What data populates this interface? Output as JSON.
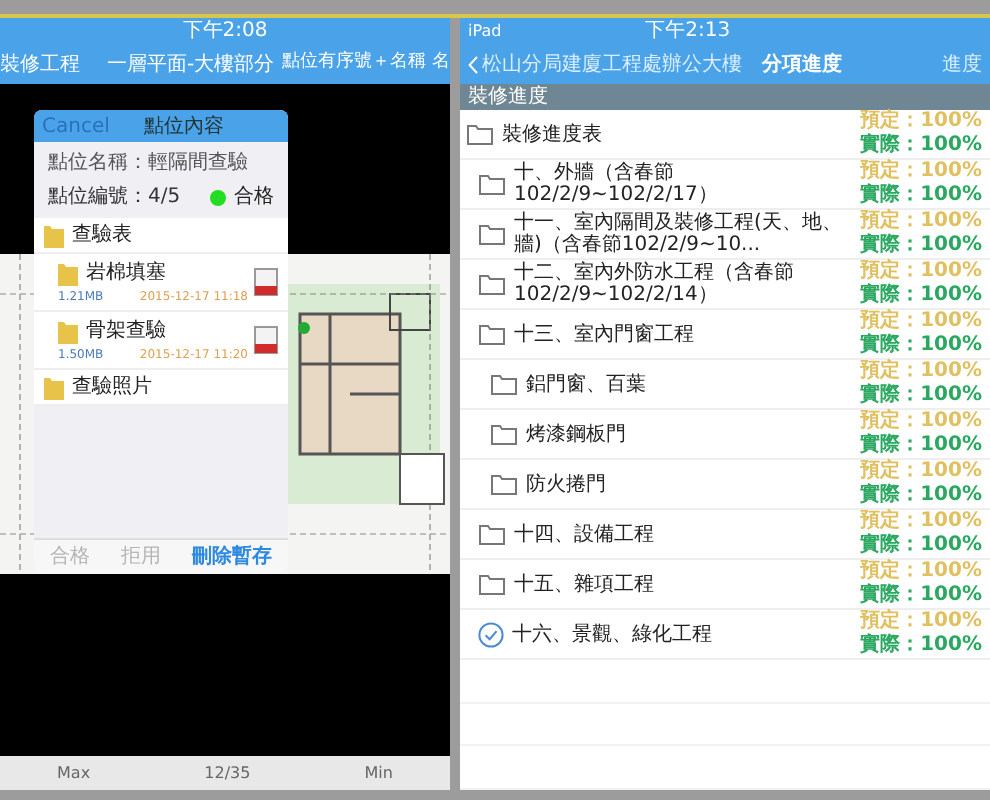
{
  "left": {
    "status_time": "下午2:08",
    "nav": {
      "back_title": "裝修工程",
      "title": "一層平面-大樓部分",
      "right": "點位有序號＋名稱 名"
    },
    "dialog": {
      "cancel": "Cancel",
      "title": "點位內容",
      "point_name": "點位名稱：輕隔間查驗",
      "point_number": "點位編號：4/5",
      "status": {
        "label": "合格",
        "color": "#22dd22"
      },
      "items": [
        {
          "kind": "folder",
          "name": "查驗表",
          "children": [
            {
              "kind": "file",
              "name": "岩棉填塞",
              "size": "1.21MB",
              "time": "2015-12-17 11:18"
            },
            {
              "kind": "file",
              "name": "骨架查驗",
              "size": "1.50MB",
              "time": "2015-12-17 11:20"
            }
          ]
        },
        {
          "kind": "folder",
          "name": "查驗照片"
        }
      ],
      "actions": [
        {
          "label": "合格",
          "disabled": true
        },
        {
          "label": "拒用",
          "disabled": true
        },
        {
          "label": "刪除暫存",
          "disabled": false
        }
      ]
    },
    "footer": [
      "Max",
      "12/35",
      "Min"
    ]
  },
  "right": {
    "status_device": "iPad",
    "status_time": "下午2:13",
    "nav": {
      "back_title": "松山分局建廈工程處辦公大樓",
      "title": "分項進度",
      "right": "進度"
    },
    "section": "裝修進度",
    "rows": [
      {
        "kind": "folder",
        "name": "裝修進度表",
        "planned": "預定：100%",
        "actual": "實際：100%",
        "children": [
          {
            "kind": "folder",
            "name": "十、外牆（含春節102/2/9~102/2/17）",
            "planned": "預定：100%",
            "actual": "實際：100%"
          },
          {
            "kind": "folder",
            "name": "十一、室內隔間及裝修工程(天、地、牆)（含春節102/2/9~10...",
            "planned": "預定：100%",
            "actual": "實際：100%"
          },
          {
            "kind": "folder",
            "name": "十二、室內外防水工程（含春節102/2/9~102/2/14）",
            "planned": "預定：100%",
            "actual": "實際：100%"
          },
          {
            "kind": "folder",
            "name": "十三、室內門窗工程",
            "planned": "預定：100%",
            "actual": "實際：100%",
            "children": [
              {
                "kind": "folder",
                "name": "鋁門窗、百葉",
                "planned": "預定：100%",
                "actual": "實際：100%"
              },
              {
                "kind": "folder",
                "name": "烤漆鋼板門",
                "planned": "預定：100%",
                "actual": "實際：100%"
              },
              {
                "kind": "folder",
                "name": "防火捲門",
                "planned": "預定：100%",
                "actual": "實際：100%"
              }
            ]
          },
          {
            "kind": "folder",
            "name": "十四、設備工程",
            "planned": "預定：100%",
            "actual": "實際：100%"
          },
          {
            "kind": "folder",
            "name": "十五、雜項工程",
            "planned": "預定：100%",
            "actual": "實際：100%"
          },
          {
            "kind": "done",
            "name": "十六、景觀、綠化工程",
            "planned": "預定：100%",
            "actual": "實際：100%"
          }
        ]
      }
    ]
  }
}
